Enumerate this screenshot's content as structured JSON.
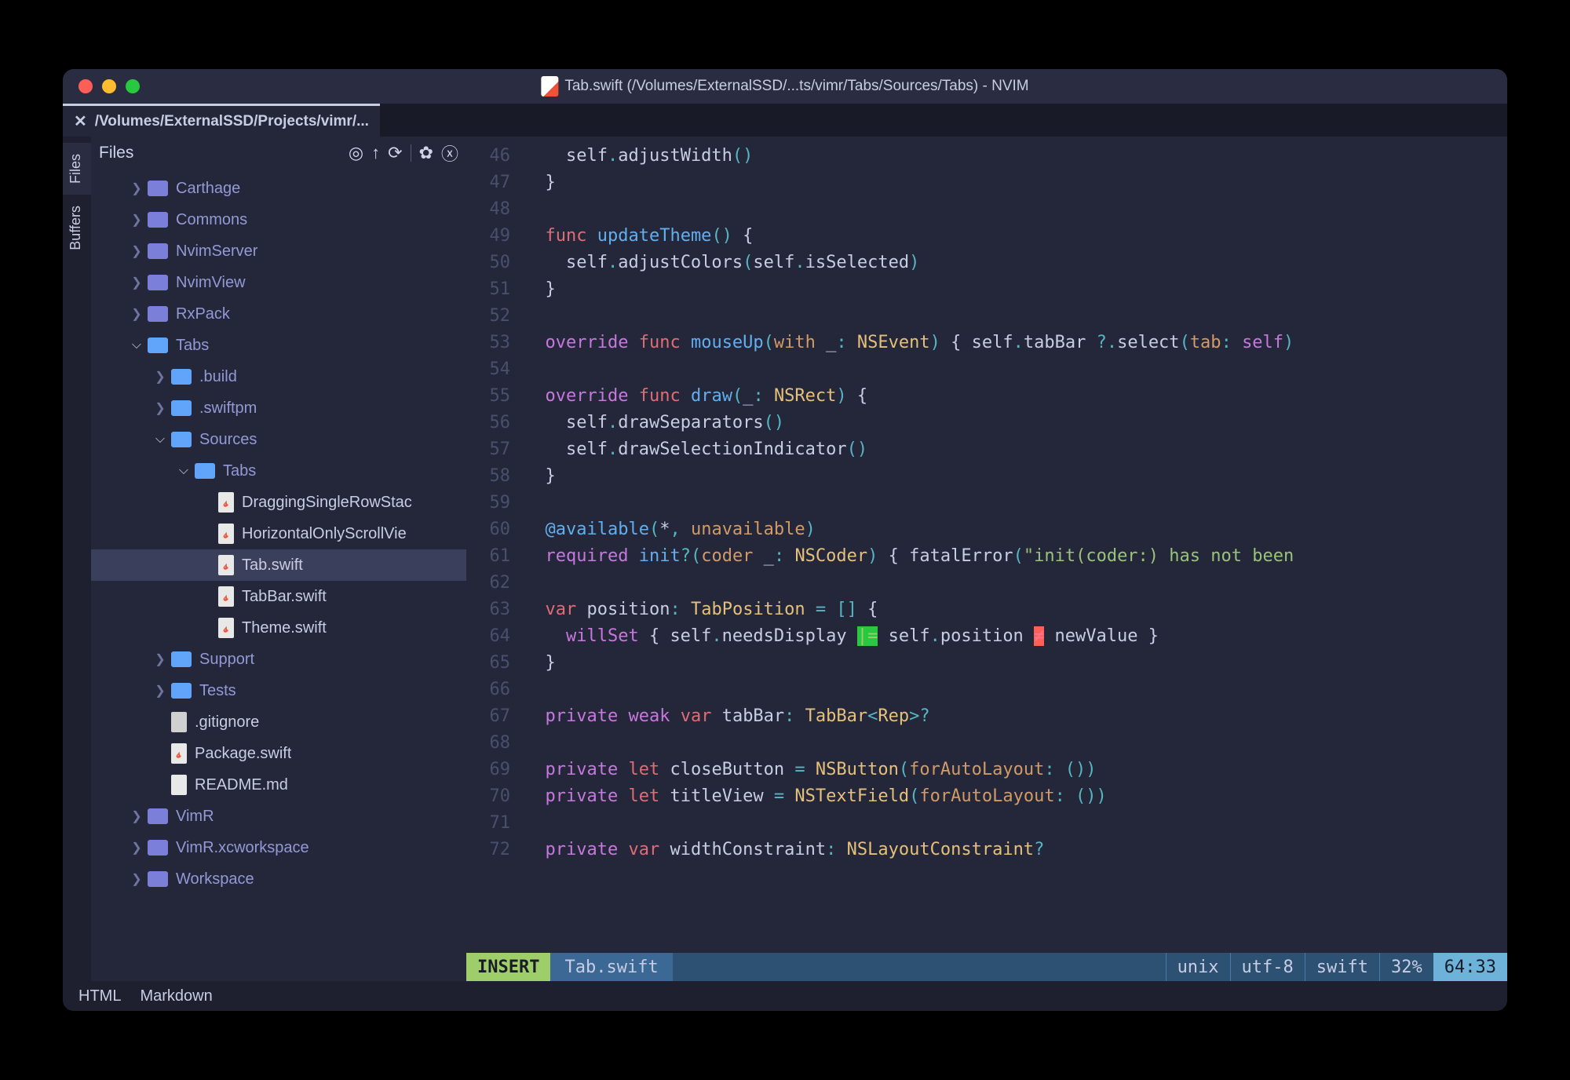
{
  "window": {
    "title": "Tab.swift (/Volumes/ExternalSSD/...ts/vimr/Tabs/Sources/Tabs) - NVIM"
  },
  "tab": {
    "label": "/Volumes/ExternalSSD/Projects/vimr/..."
  },
  "side_tabs": {
    "files": "Files",
    "buffers": "Buffers"
  },
  "sidebar": {
    "title": "Files"
  },
  "tree": [
    {
      "indent": 1,
      "type": "folder-closed",
      "chev": ">",
      "name": "Carthage"
    },
    {
      "indent": 1,
      "type": "folder-closed",
      "chev": ">",
      "name": "Commons"
    },
    {
      "indent": 1,
      "type": "folder-closed",
      "chev": ">",
      "name": "NvimServer"
    },
    {
      "indent": 1,
      "type": "folder-closed",
      "chev": ">",
      "name": "NvimView"
    },
    {
      "indent": 1,
      "type": "folder-closed",
      "chev": ">",
      "name": "RxPack"
    },
    {
      "indent": 1,
      "type": "folder-open",
      "chev": "v",
      "name": "Tabs"
    },
    {
      "indent": 2,
      "type": "folder-open",
      "chev": ">",
      "name": ".build"
    },
    {
      "indent": 2,
      "type": "folder-open",
      "chev": ">",
      "name": ".swiftpm"
    },
    {
      "indent": 2,
      "type": "folder-open",
      "chev": "v",
      "name": "Sources"
    },
    {
      "indent": 3,
      "type": "folder-open",
      "chev": "v",
      "name": "Tabs"
    },
    {
      "indent": 4,
      "type": "file-swift",
      "name": "DraggingSingleRowStac"
    },
    {
      "indent": 4,
      "type": "file-swift",
      "name": "HorizontalOnlyScrollVie"
    },
    {
      "indent": 4,
      "type": "file-swift",
      "name": "Tab.swift",
      "selected": true
    },
    {
      "indent": 4,
      "type": "file-swift",
      "name": "TabBar.swift"
    },
    {
      "indent": 4,
      "type": "file-swift",
      "name": "Theme.swift"
    },
    {
      "indent": 2,
      "type": "folder-open",
      "chev": ">",
      "name": "Support"
    },
    {
      "indent": 2,
      "type": "folder-open",
      "chev": ">",
      "name": "Tests"
    },
    {
      "indent": 2,
      "type": "file-txt",
      "name": ".gitignore"
    },
    {
      "indent": 2,
      "type": "file-swift",
      "name": "Package.swift"
    },
    {
      "indent": 2,
      "type": "file-md",
      "name": "README.md"
    },
    {
      "indent": 1,
      "type": "folder-closed",
      "chev": ">",
      "name": "VimR"
    },
    {
      "indent": 1,
      "type": "folder-closed",
      "chev": ">",
      "name": "VimR.xcworkspace"
    },
    {
      "indent": 1,
      "type": "folder-closed",
      "chev": ">",
      "name": "Workspace"
    }
  ],
  "code": {
    "first_line": 46,
    "lines": [
      [
        [
          "id",
          "    self"
        ],
        [
          "op",
          "."
        ],
        [
          "id",
          "adjustWidth"
        ],
        [
          "op",
          "()"
        ]
      ],
      [
        [
          "id",
          "  }"
        ]
      ],
      [],
      [
        [
          "id",
          "  "
        ],
        [
          "kw2",
          "func"
        ],
        [
          "id",
          " "
        ],
        [
          "fn",
          "updateTheme"
        ],
        [
          "op",
          "()"
        ],
        [
          "id",
          " {"
        ]
      ],
      [
        [
          "id",
          "    self"
        ],
        [
          "op",
          "."
        ],
        [
          "id",
          "adjustColors"
        ],
        [
          "op",
          "("
        ],
        [
          "id",
          "self"
        ],
        [
          "op",
          "."
        ],
        [
          "id",
          "isSelected"
        ],
        [
          "op",
          ")"
        ]
      ],
      [
        [
          "id",
          "  }"
        ]
      ],
      [],
      [
        [
          "id",
          "  "
        ],
        [
          "kw",
          "override"
        ],
        [
          "id",
          " "
        ],
        [
          "kw2",
          "func"
        ],
        [
          "id",
          " "
        ],
        [
          "fn",
          "mouseUp"
        ],
        [
          "op",
          "("
        ],
        [
          "param",
          "with"
        ],
        [
          "id",
          " _"
        ],
        [
          "op",
          ": "
        ],
        [
          "type",
          "NSEvent"
        ],
        [
          "op",
          ")"
        ],
        [
          "id",
          " { self"
        ],
        [
          "op",
          "."
        ],
        [
          "id",
          "tabBar"
        ],
        [
          "op",
          " ?."
        ],
        [
          "id",
          "select"
        ],
        [
          "op",
          "("
        ],
        [
          "param",
          "tab"
        ],
        [
          "op",
          ": "
        ],
        [
          "kw",
          "self"
        ],
        [
          "op",
          ")"
        ]
      ],
      [],
      [
        [
          "id",
          "  "
        ],
        [
          "kw",
          "override"
        ],
        [
          "id",
          " "
        ],
        [
          "kw2",
          "func"
        ],
        [
          "id",
          " "
        ],
        [
          "fn",
          "draw"
        ],
        [
          "op",
          "("
        ],
        [
          "id",
          "_"
        ],
        [
          "op",
          ": "
        ],
        [
          "type",
          "NSRect"
        ],
        [
          "op",
          ")"
        ],
        [
          "id",
          " {"
        ]
      ],
      [
        [
          "id",
          "    self"
        ],
        [
          "op",
          "."
        ],
        [
          "id",
          "drawSeparators"
        ],
        [
          "op",
          "()"
        ]
      ],
      [
        [
          "id",
          "    self"
        ],
        [
          "op",
          "."
        ],
        [
          "id",
          "drawSelectionIndicator"
        ],
        [
          "op",
          "()"
        ]
      ],
      [
        [
          "id",
          "  }"
        ]
      ],
      [],
      [
        [
          "id",
          "  "
        ],
        [
          "fn",
          "@available"
        ],
        [
          "op",
          "("
        ],
        [
          "id",
          "*"
        ],
        [
          "op",
          ", "
        ],
        [
          "param",
          "unavailable"
        ],
        [
          "op",
          ")"
        ]
      ],
      [
        [
          "id",
          "  "
        ],
        [
          "kw",
          "required"
        ],
        [
          "id",
          " "
        ],
        [
          "fn",
          "init"
        ],
        [
          "op",
          "?("
        ],
        [
          "param",
          "coder"
        ],
        [
          "id",
          " _"
        ],
        [
          "op",
          ": "
        ],
        [
          "type",
          "NSCoder"
        ],
        [
          "op",
          ")"
        ],
        [
          "id",
          " { "
        ],
        [
          "id",
          "fatalError"
        ],
        [
          "op",
          "("
        ],
        [
          "str",
          "\"init(coder:) has not been"
        ]
      ],
      [],
      [
        [
          "id",
          "  "
        ],
        [
          "kw2",
          "var"
        ],
        [
          "id",
          " position"
        ],
        [
          "op",
          ": "
        ],
        [
          "type",
          "TabPosition"
        ],
        [
          "id",
          " "
        ],
        [
          "op",
          "="
        ],
        [
          "id",
          " "
        ],
        [
          "op",
          "[]"
        ],
        [
          "id",
          " {"
        ]
      ],
      [
        [
          "id",
          "    "
        ],
        [
          "kw",
          "willSet"
        ],
        [
          "id",
          " { self"
        ],
        [
          "op",
          "."
        ],
        [
          "id",
          "needsDisplay "
        ],
        [
          "green",
          "|="
        ],
        [
          "id",
          " self"
        ],
        [
          "op",
          "."
        ],
        [
          "id",
          "position "
        ],
        [
          "red",
          "≠"
        ],
        [
          "id",
          " newValue }"
        ]
      ],
      [
        [
          "id",
          "  }"
        ]
      ],
      [],
      [
        [
          "id",
          "  "
        ],
        [
          "kw",
          "private"
        ],
        [
          "id",
          " "
        ],
        [
          "kw",
          "weak"
        ],
        [
          "id",
          " "
        ],
        [
          "kw2",
          "var"
        ],
        [
          "id",
          " tabBar"
        ],
        [
          "op",
          ": "
        ],
        [
          "type",
          "TabBar"
        ],
        [
          "op",
          "<"
        ],
        [
          "type",
          "Rep"
        ],
        [
          "op",
          ">?"
        ]
      ],
      [],
      [
        [
          "id",
          "  "
        ],
        [
          "kw",
          "private"
        ],
        [
          "id",
          " "
        ],
        [
          "kw2",
          "let"
        ],
        [
          "id",
          " closeButton "
        ],
        [
          "op",
          "="
        ],
        [
          "id",
          " "
        ],
        [
          "type",
          "NSButton"
        ],
        [
          "op",
          "("
        ],
        [
          "param",
          "forAutoLayout"
        ],
        [
          "op",
          ": ())"
        ]
      ],
      [
        [
          "id",
          "  "
        ],
        [
          "kw",
          "private"
        ],
        [
          "id",
          " "
        ],
        [
          "kw2",
          "let"
        ],
        [
          "id",
          " titleView "
        ],
        [
          "op",
          "="
        ],
        [
          "id",
          " "
        ],
        [
          "type",
          "NSTextField"
        ],
        [
          "op",
          "("
        ],
        [
          "param",
          "forAutoLayout"
        ],
        [
          "op",
          ": ())"
        ]
      ],
      [],
      [
        [
          "id",
          "  "
        ],
        [
          "kw",
          "private"
        ],
        [
          "id",
          " "
        ],
        [
          "kw2",
          "var"
        ],
        [
          "id",
          " widthConstraint"
        ],
        [
          "op",
          ": "
        ],
        [
          "type",
          "NSLayoutConstraint"
        ],
        [
          "op",
          "?"
        ]
      ]
    ]
  },
  "status": {
    "mode": "INSERT",
    "file": "Tab.swift",
    "format": "unix",
    "encoding": "utf-8",
    "lang": "swift",
    "percent": "32%",
    "position": "64:33"
  },
  "bottom": {
    "html": "HTML",
    "markdown": "Markdown"
  }
}
